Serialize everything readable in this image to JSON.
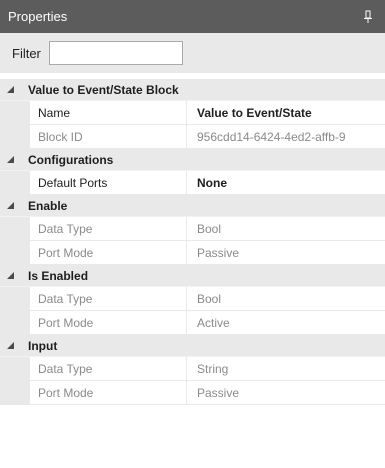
{
  "panel": {
    "title": "Properties",
    "filter_label": "Filter",
    "filter_value": ""
  },
  "categories": [
    {
      "label": "Value to Event/State Block",
      "rows": [
        {
          "name": "Name",
          "value": "Value to Event/State"
        },
        {
          "name": "Block ID",
          "value": "956cdd14-6424-4ed2-affb-9"
        }
      ]
    },
    {
      "label": "Configurations",
      "rows": [
        {
          "name": "Default Ports",
          "value": "None"
        }
      ]
    },
    {
      "label": "Enable",
      "rows": [
        {
          "name": "Data Type",
          "value": "Bool"
        },
        {
          "name": "Port Mode",
          "value": "Passive"
        }
      ]
    },
    {
      "label": "Is Enabled",
      "rows": [
        {
          "name": "Data Type",
          "value": "Bool"
        },
        {
          "name": "Port Mode",
          "value": "Active"
        }
      ]
    },
    {
      "label": "Input",
      "rows": [
        {
          "name": "Data Type",
          "value": "String"
        },
        {
          "name": "Port Mode",
          "value": "Passive"
        }
      ]
    }
  ]
}
